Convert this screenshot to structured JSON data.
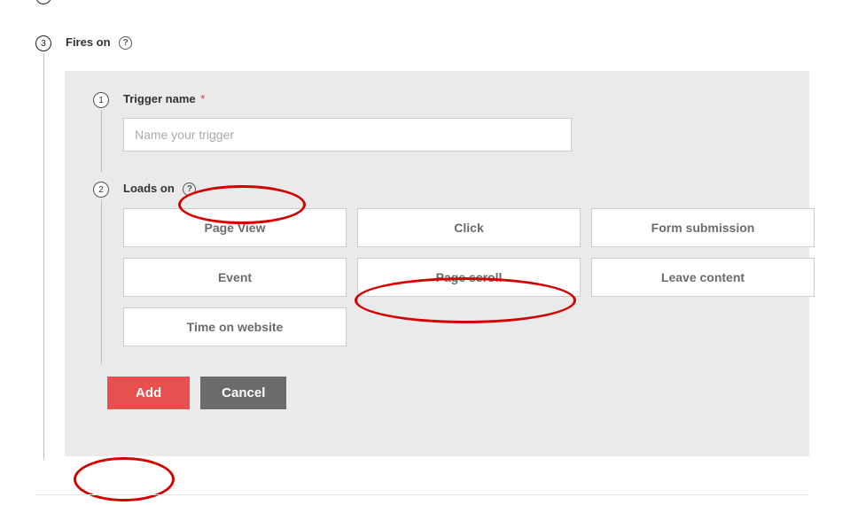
{
  "outer_step": {
    "prev_number": "",
    "number": "3",
    "label": "Fires on"
  },
  "sub1": {
    "number": "1",
    "label": "Trigger name",
    "required_mark": "*",
    "input_value": "",
    "input_placeholder": "Name your trigger"
  },
  "sub2": {
    "number": "2",
    "label": "Loads on",
    "options": [
      "Page View",
      "Click",
      "Form submission",
      "Event",
      "Page scroll",
      "Leave content",
      "Time on website"
    ]
  },
  "footer": {
    "add_label": "Add",
    "cancel_label": "Cancel"
  },
  "help_glyph": "?"
}
